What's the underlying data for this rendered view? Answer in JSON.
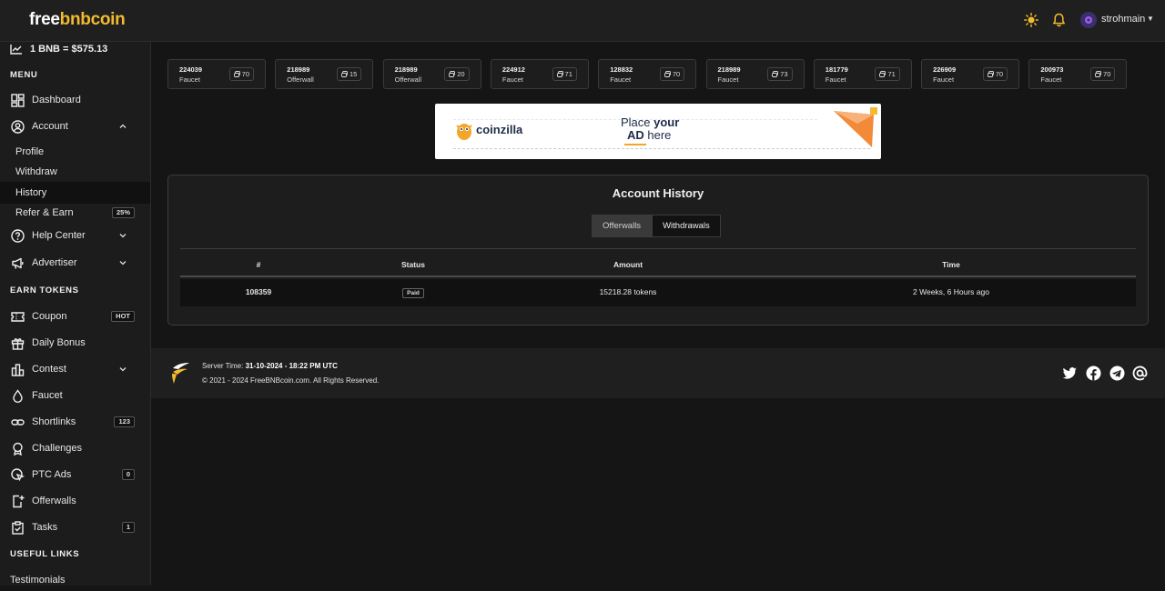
{
  "brand": {
    "part1": "free",
    "part2": "bnbcoin"
  },
  "header": {
    "username": "strohmain"
  },
  "sidebar": {
    "price": "1 BNB = $575.13",
    "sections": {
      "menu": "MENU",
      "earn": "EARN TOKENS",
      "links": "USEFUL LINKS"
    },
    "items": {
      "dashboard": "Dashboard",
      "account": "Account",
      "profile": "Profile",
      "withdraw": "Withdraw",
      "history": "History",
      "refer": "Refer & Earn",
      "refer_badge": "25%",
      "help": "Help Center",
      "advertiser": "Advertiser",
      "coupon": "Coupon",
      "coupon_badge": "HOT",
      "daily": "Daily Bonus",
      "contest": "Contest",
      "faucet": "Faucet",
      "shortlinks": "Shortlinks",
      "shortlinks_badge": "123",
      "challenges": "Challenges",
      "ptc": "PTC Ads",
      "ptc_badge": "0",
      "offerwalls": "Offerwalls",
      "tasks": "Tasks",
      "tasks_badge": "1",
      "testimonials": "Testimonials"
    }
  },
  "feed": [
    {
      "id": "224039",
      "type": "Faucet",
      "amount": "70"
    },
    {
      "id": "218989",
      "type": "Offerwall",
      "amount": "15"
    },
    {
      "id": "218989",
      "type": "Offerwall",
      "amount": "20"
    },
    {
      "id": "224912",
      "type": "Faucet",
      "amount": "71"
    },
    {
      "id": "128832",
      "type": "Faucet",
      "amount": "70"
    },
    {
      "id": "218989",
      "type": "Faucet",
      "amount": "73"
    },
    {
      "id": "181779",
      "type": "Faucet",
      "amount": "71"
    },
    {
      "id": "226909",
      "type": "Faucet",
      "amount": "70"
    },
    {
      "id": "200973",
      "type": "Faucet",
      "amount": "70"
    }
  ],
  "ad": {
    "brand": "coinzilla",
    "line1a": "Place ",
    "line1b": "your",
    "line2a": "AD",
    "line2b": " here"
  },
  "history": {
    "title": "Account History",
    "tabs": [
      "Offerwalls",
      "Withdrawals"
    ],
    "columns": [
      "#",
      "Status",
      "Amount",
      "Time"
    ],
    "rows": [
      {
        "id": "108359",
        "status": "Paid",
        "amount": "15218.28 tokens",
        "time": "2 Weeks, 6 Hours ago"
      }
    ]
  },
  "footer": {
    "server_label": "Server Time: ",
    "server_time": "31-10-2024 - 18:22 PM UTC",
    "copyright": "© 2021 - 2024 FreeBNBcoin.com. All Rights Reserved."
  },
  "colors": {
    "accent": "#f3ba2f",
    "bg": "#151515",
    "panel": "#1d1d1d"
  }
}
